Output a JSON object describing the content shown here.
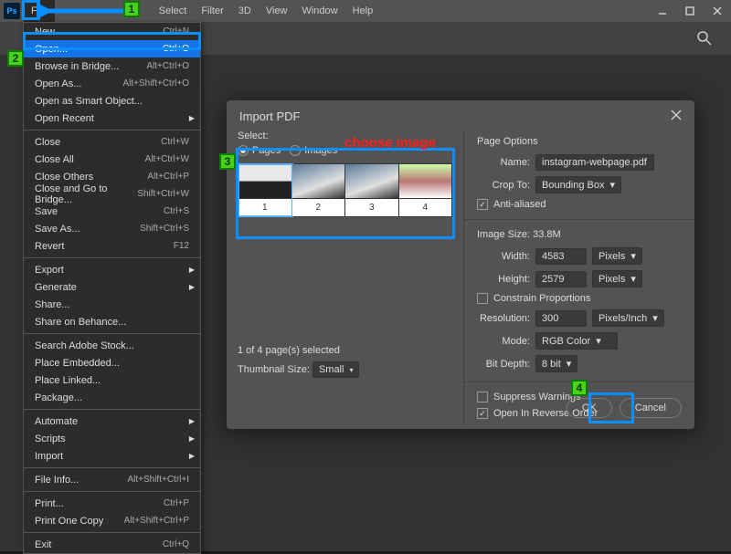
{
  "menubar": {
    "items": [
      "File",
      "Select",
      "Filter",
      "3D",
      "View",
      "Window",
      "Help"
    ]
  },
  "dropdown": [
    {
      "label": "New...",
      "key": "Ctrl+N"
    },
    {
      "label": "Open...",
      "key": "Ctrl+O",
      "hl": true
    },
    {
      "label": "Browse in Bridge...",
      "key": "Alt+Ctrl+O"
    },
    {
      "label": "Open As...",
      "key": "Alt+Shift+Ctrl+O"
    },
    {
      "label": "Open as Smart Object..."
    },
    {
      "label": "Open Recent",
      "sub": true
    },
    {
      "sep": true
    },
    {
      "label": "Close",
      "key": "Ctrl+W"
    },
    {
      "label": "Close All",
      "key": "Alt+Ctrl+W"
    },
    {
      "label": "Close Others",
      "key": "Alt+Ctrl+P"
    },
    {
      "label": "Close and Go to Bridge...",
      "key": "Shift+Ctrl+W"
    },
    {
      "label": "Save",
      "key": "Ctrl+S"
    },
    {
      "label": "Save As...",
      "key": "Shift+Ctrl+S"
    },
    {
      "label": "Revert",
      "key": "F12"
    },
    {
      "sep": true
    },
    {
      "label": "Export",
      "sub": true
    },
    {
      "label": "Generate",
      "sub": true
    },
    {
      "label": "Share..."
    },
    {
      "label": "Share on Behance..."
    },
    {
      "sep": true
    },
    {
      "label": "Search Adobe Stock..."
    },
    {
      "label": "Place Embedded..."
    },
    {
      "label": "Place Linked..."
    },
    {
      "label": "Package..."
    },
    {
      "sep": true
    },
    {
      "label": "Automate",
      "sub": true
    },
    {
      "label": "Scripts",
      "sub": true
    },
    {
      "label": "Import",
      "sub": true
    },
    {
      "sep": true
    },
    {
      "label": "File Info...",
      "key": "Alt+Shift+Ctrl+I"
    },
    {
      "sep": true
    },
    {
      "label": "Print...",
      "key": "Ctrl+P"
    },
    {
      "label": "Print One Copy",
      "key": "Alt+Shift+Ctrl+P"
    },
    {
      "sep": true
    },
    {
      "label": "Exit",
      "key": "Ctrl+Q"
    }
  ],
  "dialog": {
    "title": "Import PDF",
    "select_label": "Select:",
    "radios": [
      {
        "label": "Pages",
        "checked": true
      },
      {
        "label": "Images",
        "checked": false
      }
    ],
    "thumbs": [
      "1",
      "2",
      "3",
      "4"
    ],
    "status": "1 of 4 page(s) selected",
    "thumbsize_label": "Thumbnail Size:",
    "thumbsize_value": "Small",
    "page_options": "Page Options",
    "name_label": "Name:",
    "name_value": "instagram-webpage.pdf",
    "cropto_label": "Crop To:",
    "cropto_value": "Bounding Box",
    "antialias": "Anti-aliased",
    "imgsize": "Image Size: 33.8M",
    "width_label": "Width:",
    "width_value": "4583",
    "height_label": "Height:",
    "height_value": "2579",
    "px_units": "Pixels",
    "constrain": "Constrain Proportions",
    "res_label": "Resolution:",
    "res_value": "300",
    "res_units": "Pixels/Inch",
    "mode_label": "Mode:",
    "mode_value": "RGB Color",
    "bitdepth_label": "Bit Depth:",
    "bitdepth_value": "8 bit",
    "suppress": "Suppress Warnings",
    "reverse": "Open In Reverse Order",
    "ok": "OK",
    "cancel": "Cancel"
  },
  "annot": {
    "choose": "choose image",
    "tag1": "1",
    "tag2": "2",
    "tag3": "3",
    "tag4": "4"
  }
}
